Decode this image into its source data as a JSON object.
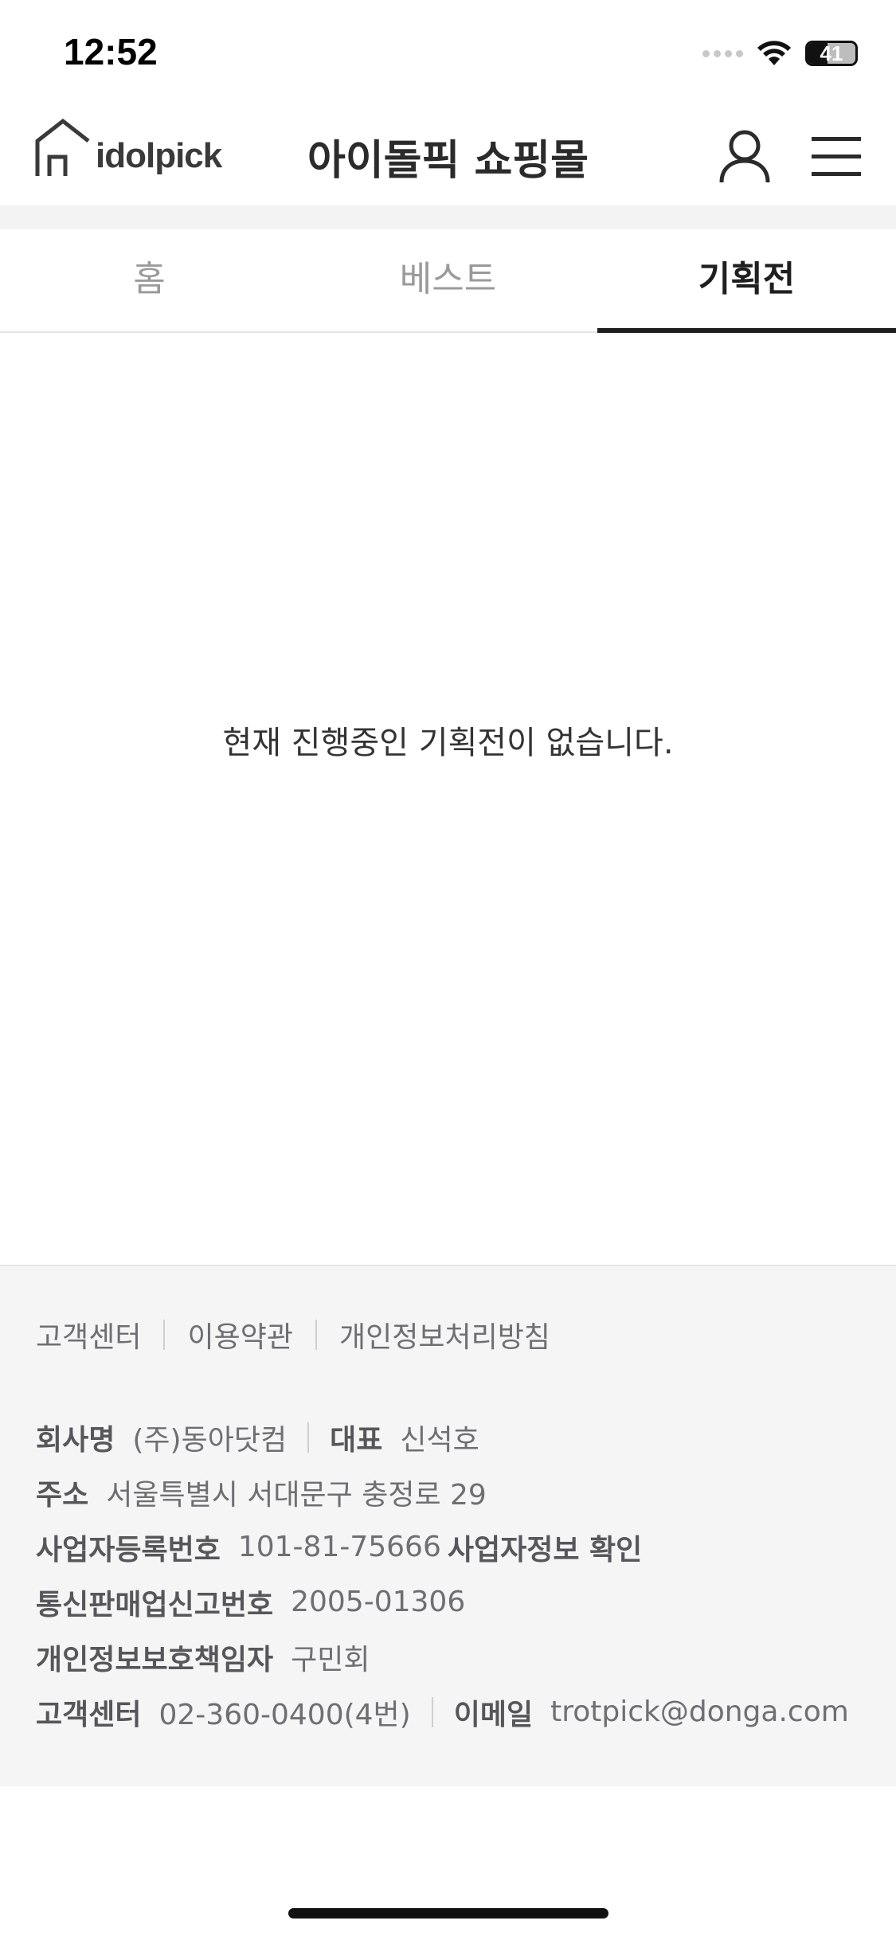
{
  "status_bar": {
    "time": "12:52",
    "battery_level": "41",
    "battery_fraction": 0.41
  },
  "header": {
    "logo_text": "idolpick",
    "title": "아이돌픽 쇼핑몰",
    "user_icon": "user-icon",
    "menu_icon": "hamburger-menu-icon"
  },
  "tabs": [
    {
      "label": "홈",
      "active": false
    },
    {
      "label": "베스트",
      "active": false
    },
    {
      "label": "기획전",
      "active": true
    }
  ],
  "content": {
    "empty_message": "현재 진행중인 기획전이 없습니다."
  },
  "footer": {
    "links": [
      "고객센터",
      "이용약관",
      "개인정보처리방침"
    ],
    "company_label": "회사명",
    "company_value": "(주)동아닷컴",
    "ceo_label": "대표",
    "ceo_value": "신석호",
    "address_label": "주소",
    "address_value": "서울특별시 서대문구 충정로 29",
    "bizno_label": "사업자등록번호",
    "bizno_value": "101-81-75666",
    "bizinfo_link": "사업자정보 확인",
    "telecom_label": "통신판매업신고번호",
    "telecom_value": "2005-01306",
    "privacy_label": "개인정보보호책임자",
    "privacy_value": "구민회",
    "cs_label": "고객센터",
    "cs_value": "02-360-0400(4번)",
    "email_label": "이메일",
    "email_value": "trotpick@donga.com"
  }
}
